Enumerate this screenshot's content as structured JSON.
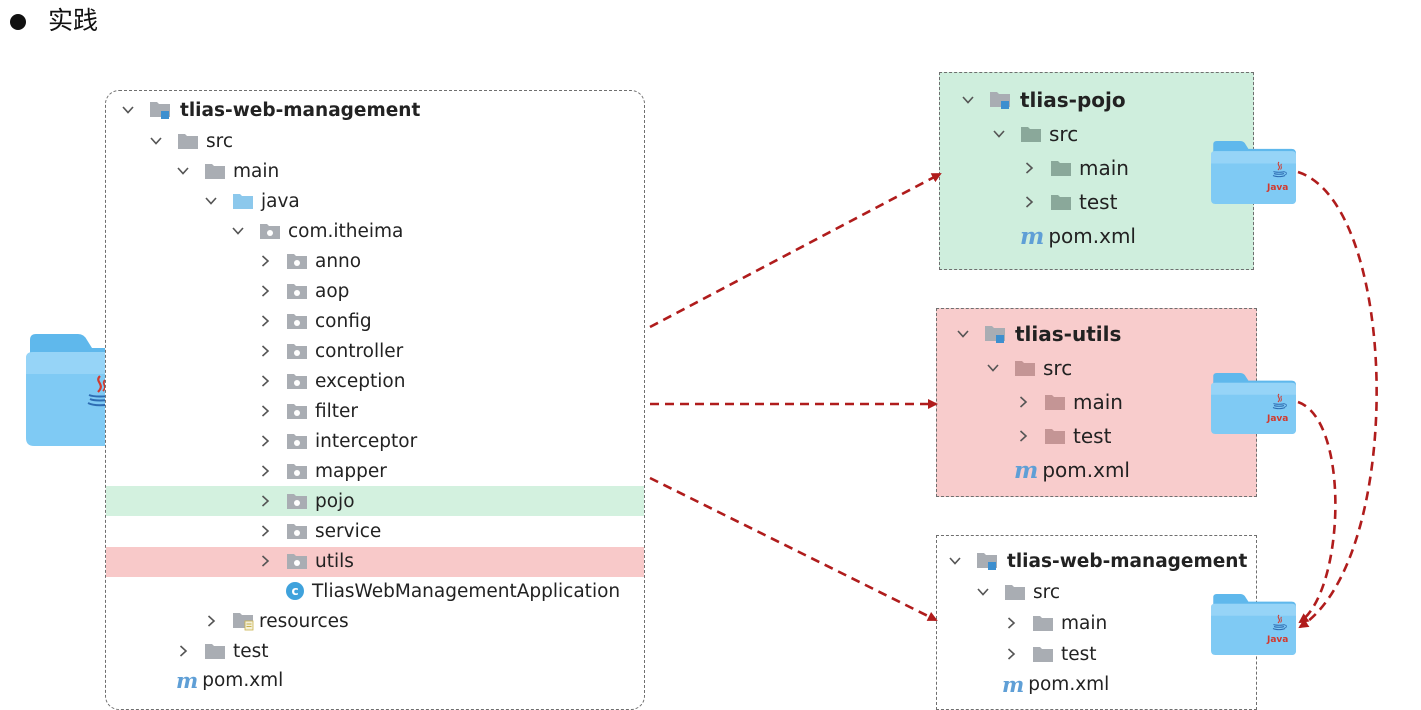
{
  "heading": {
    "text": "实践"
  },
  "main_tree": {
    "root": "tlias-web-management",
    "src": "src",
    "main": "main",
    "java": "java",
    "package": "com.itheima",
    "packages": [
      "anno",
      "aop",
      "config",
      "controller",
      "exception",
      "filter",
      "interceptor",
      "mapper",
      "pojo",
      "service",
      "utils"
    ],
    "app_class": "TliasWebManagementApplication",
    "resources": "resources",
    "test": "test",
    "pom": "pom.xml"
  },
  "modules": [
    {
      "name": "tlias-pojo",
      "src": "src",
      "main": "main",
      "test": "test",
      "pom": "pom.xml",
      "color": "#cfeedd"
    },
    {
      "name": "tlias-utils",
      "src": "src",
      "main": "main",
      "test": "test",
      "pom": "pom.xml",
      "color": "#f8cccc"
    },
    {
      "name": "tlias-web-management",
      "src": "src",
      "main": "main",
      "test": "test",
      "pom": "pom.xml",
      "color": "#ffffff"
    }
  ],
  "java_folder_label": "Java",
  "colors": {
    "arrow": "#b01c1c",
    "folder_blue": "#6ec3f2",
    "highlight_pojo": "#d3f1df",
    "highlight_utils": "#f8c9c9"
  }
}
